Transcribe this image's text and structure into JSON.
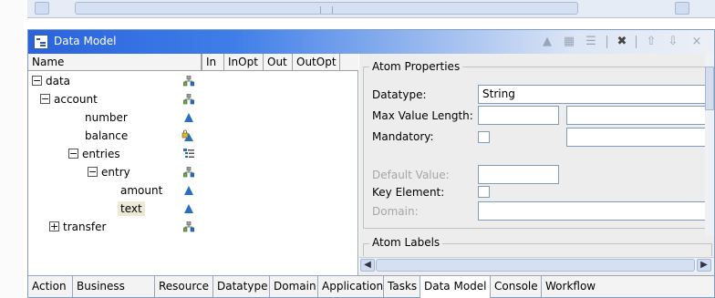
{
  "window": {
    "title": "Data Model",
    "toolbar_icons": [
      "triangle-icon",
      "hierarchy-icon",
      "tree-view-icon",
      "delete-icon",
      "move-up-icon",
      "move-down-icon",
      "close-icon"
    ],
    "accent_color": "#2a63dd"
  },
  "tree": {
    "columns": [
      "Name",
      "In",
      "InOpt",
      "Out",
      "OutOpt"
    ],
    "rows": [
      {
        "label": "data",
        "expander": "−",
        "icon": "group-node-icon"
      },
      {
        "label": "account",
        "expander": "−",
        "icon": "group-node-icon"
      },
      {
        "label": "number",
        "expander": "",
        "icon": "atom-icon"
      },
      {
        "label": "balance",
        "expander": "",
        "icon": "locked-atom-icon"
      },
      {
        "label": "entries",
        "expander": "−",
        "icon": "list-node-icon"
      },
      {
        "label": "entry",
        "expander": "−",
        "icon": "group-node-icon"
      },
      {
        "label": "amount",
        "expander": "",
        "icon": "atom-icon"
      },
      {
        "label": "text",
        "expander": "",
        "icon": "atom-icon",
        "selected": true
      },
      {
        "label": "transfer",
        "expander": "+",
        "icon": "group-node-icon"
      }
    ]
  },
  "properties": {
    "atom_properties_title": "Atom Properties",
    "datatype_label": "Datatype:",
    "datatype_value": "String",
    "max_length_label": "Max Value Length:",
    "mandatory_label": "Mandatory:",
    "default_value_label": "Default Value:",
    "key_element_label": "Key Element:",
    "domain_label": "Domain:",
    "atom_labels_title": "Atom Labels"
  },
  "tabs": [
    "Action",
    "Business Logic",
    "Resource",
    "Datatype",
    "Domain",
    "Application",
    "Tasks",
    "Data Model",
    "Console",
    "Workflow"
  ]
}
